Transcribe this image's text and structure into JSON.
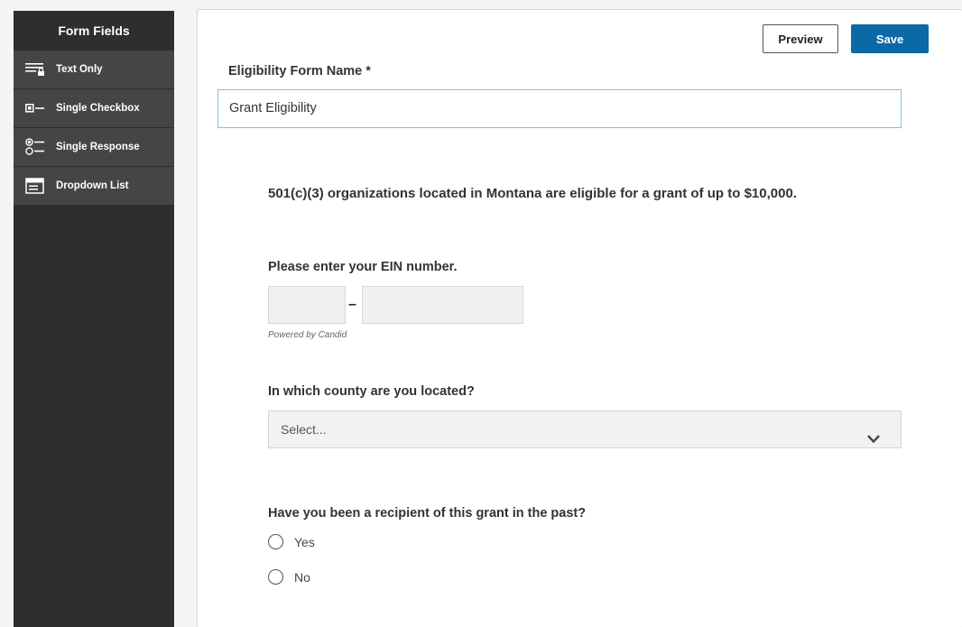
{
  "sidebar": {
    "title": "Form Fields",
    "items": [
      {
        "label": "Text Only",
        "icon": "text-only-icon"
      },
      {
        "label": "Single Checkbox",
        "icon": "checkbox-icon"
      },
      {
        "label": "Single Response",
        "icon": "radio-list-icon"
      },
      {
        "label": "Dropdown List",
        "icon": "dropdown-list-icon"
      }
    ]
  },
  "toolbar": {
    "preview_label": "Preview",
    "save_label": "Save"
  },
  "form": {
    "name_label": "Eligibility Form Name *",
    "name_value": "Grant Eligibility",
    "text_only": "501(c)(3) organizations located in Montana are eligible for a grant of up to $10,000.",
    "ein_question": "Please enter your EIN number.",
    "ein_dash": "–",
    "powered_by": "Powered by Candid",
    "county_question": "In which county are you located?",
    "county_placeholder": "Select...",
    "recipient_question": "Have you been a recipient of this grant in the past?",
    "options": [
      "Yes",
      "No"
    ]
  },
  "colors": {
    "sidebar_bg": "#2e2e2e",
    "sidebar_item_bg": "#454545",
    "accent": "#0b6aa5",
    "input_focus_border": "#7fc2e6"
  }
}
